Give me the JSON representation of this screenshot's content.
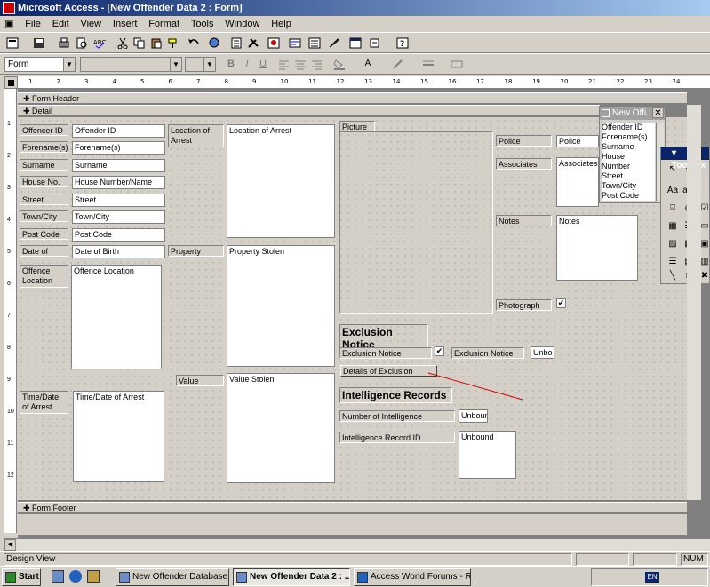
{
  "window": {
    "title": "Microsoft Access - [New Offender Data 2 : Form]"
  },
  "menu": [
    "File",
    "Edit",
    "View",
    "Insert",
    "Format",
    "Tools",
    "Window",
    "Help"
  ],
  "format_toolbar": {
    "object_combo": "Form",
    "font_combo": "",
    "size_combo": ""
  },
  "ruler": {
    "ticks": [
      "1",
      "2",
      "3",
      "4",
      "5",
      "6",
      "7",
      "8",
      "9",
      "10",
      "11",
      "12",
      "13",
      "14",
      "15",
      "16",
      "17",
      "18",
      "19",
      "20",
      "21",
      "22",
      "23",
      "24"
    ]
  },
  "sections": {
    "header": "Form Header",
    "detail": "Detail",
    "footer": "Form Footer"
  },
  "form": {
    "left_labels": [
      "Offencer ID",
      "Forename(s)",
      "Surname",
      "House No.",
      "Street",
      "Town/City",
      "Post Code",
      "Date of Birth"
    ],
    "left_fields": [
      "Offender ID",
      "Forename(s)",
      "Surname",
      "House Number/Name",
      "Street",
      "Town/City",
      "Post Code",
      "Date of Birth"
    ],
    "offence_location_label": "Offence\nLocation",
    "offence_location_field": "Offence Location",
    "time_date_label": "Time/Date\nof Arrest",
    "time_date_field": "Time/Date of Arrest",
    "location_arrest_label": "Location of\nArrest",
    "location_arrest_field": "Location of Arrest",
    "property_label": "Property Stolen",
    "property_field": "Property Stolen",
    "value_label": "Value Stolen",
    "value_field": "Value Stolen",
    "picture_label": "Picture",
    "police_nominal_label": "Police Nominal",
    "police_nominal_field": "Police Nom",
    "associates_label": "Associates",
    "associates_field": "Associates",
    "notes_label": "Notes",
    "notes_field": "Notes",
    "photograph_label": "Photograph",
    "exclusion_heading": "Exclusion Notice",
    "exclusion_issued_label": "Exclusion Notice Issued?",
    "exclusion_id_label": "Exclusion Notice ID",
    "exclusion_id_field": "Unbo",
    "exclusion_details_button": "Details of Exclusion Notice",
    "intel_heading": "Intelligence Records",
    "intel_number_label": "Number of Intelligence Records",
    "intel_number_field": "Unbound",
    "intel_ids_label": "Intelligence Record ID Numbers",
    "intel_ids_field": "Unbound"
  },
  "field_list": {
    "title": "New Offi...",
    "items": [
      "Offender ID",
      "Forename(s)",
      "Surname",
      "House Number",
      "Street",
      "Town/City",
      "Post Code"
    ]
  },
  "toolbox": {
    "title": "Toolbox"
  },
  "status": {
    "text": "Design View",
    "num": "NUM"
  },
  "taskbar": {
    "start": "Start",
    "tasks": [
      "New Offender Database :...",
      "New Offender Data 2 : ...",
      "Access World Forums - R..."
    ],
    "lang": "EN"
  },
  "colors": {
    "title_start": "#0a246a",
    "title_end": "#a6caf0",
    "annotation_line": "#e00000"
  }
}
